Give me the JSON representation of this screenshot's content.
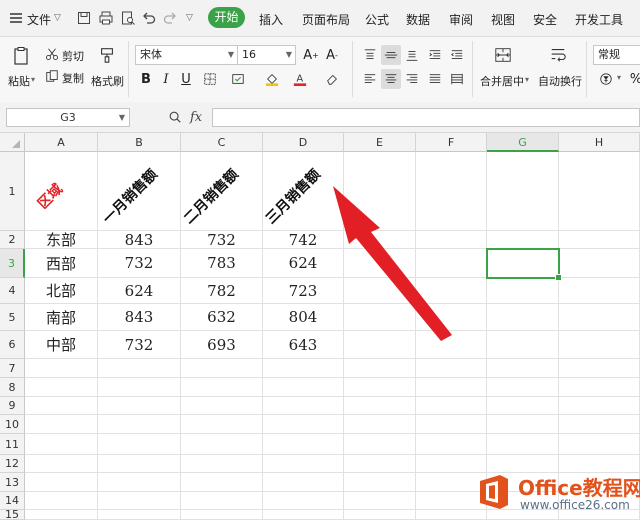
{
  "menu": {
    "file_label": "文件",
    "tabs": [
      {
        "label": "开始",
        "active": true
      },
      {
        "label": "插入"
      },
      {
        "label": "页面布局"
      },
      {
        "label": "公式"
      },
      {
        "label": "数据"
      },
      {
        "label": "审阅"
      },
      {
        "label": "视图"
      },
      {
        "label": "安全"
      },
      {
        "label": "开发工具"
      }
    ]
  },
  "ribbon": {
    "paste": "粘贴",
    "cut": "剪切",
    "copy": "复制",
    "format_painter": "格式刷",
    "font_name": "宋体",
    "font_size": "16",
    "merge_center": "合并居中",
    "wrap_text": "自动换行",
    "number_format": "常规",
    "bold": "B",
    "italic": "I",
    "underline": "U"
  },
  "formula_bar": {
    "name_box": "G3",
    "fx": "fx",
    "formula": ""
  },
  "sheet": {
    "columns": [
      "A",
      "B",
      "C",
      "D",
      "E",
      "F",
      "G",
      "H"
    ],
    "selected_column": "G",
    "selected_row": "3",
    "selected_cell": "G3",
    "row_labels": [
      "1",
      "2",
      "3",
      "4",
      "5",
      "6",
      "7",
      "8",
      "9",
      "10",
      "11",
      "12",
      "13",
      "14",
      "15"
    ],
    "headers": [
      "区域",
      "一月销售额",
      "二月销售额",
      "三月销售额"
    ],
    "rows": [
      {
        "region": "东部",
        "m1": "843",
        "m2": "732",
        "m3": "742"
      },
      {
        "region": "西部",
        "m1": "732",
        "m2": "783",
        "m3": "624"
      },
      {
        "region": "北部",
        "m1": "624",
        "m2": "782",
        "m3": "723"
      },
      {
        "region": "南部",
        "m1": "843",
        "m2": "632",
        "m3": "804"
      },
      {
        "region": "中部",
        "m1": "732",
        "m2": "693",
        "m3": "643"
      }
    ]
  },
  "watermark": {
    "brand": "Office教程网",
    "url": "www.office26.com"
  },
  "colors": {
    "accent_green": "#3aa348",
    "header_red": "#e0252b",
    "arrow_red": "#e31f26",
    "watermark_orange": "#e2521d"
  }
}
